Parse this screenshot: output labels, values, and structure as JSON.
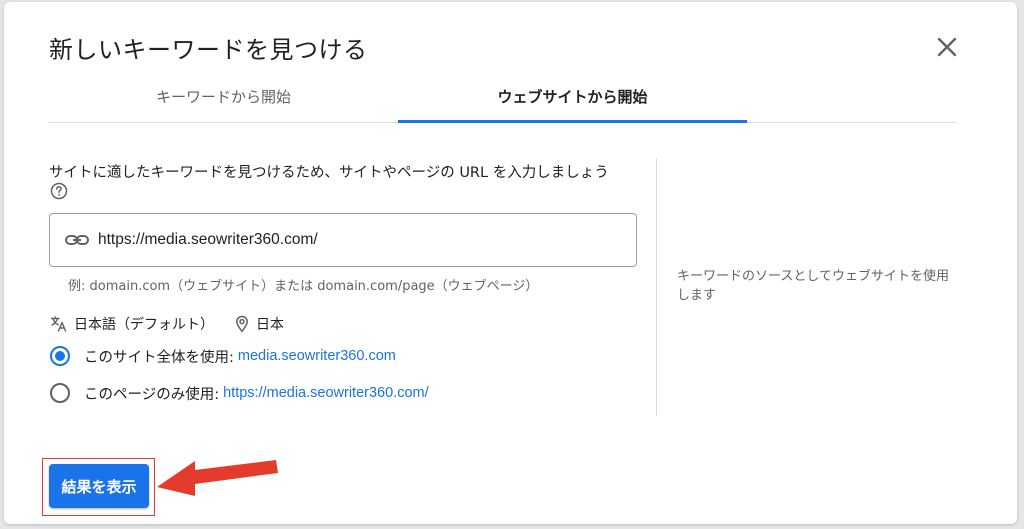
{
  "dialog": {
    "title": "新しいキーワードを見つける"
  },
  "tabs": [
    {
      "label": "キーワードから開始",
      "active": false
    },
    {
      "label": "ウェブサイトから開始",
      "active": true
    }
  ],
  "form": {
    "prompt": "サイトに適したキーワードを見つけるため、サイトやページの URL を入力しましょう",
    "url_value": "https://media.seowriter360.com/",
    "example": "例: domain.com（ウェブサイト）または domain.com/page（ウェブページ）",
    "language": "日本語（デフォルト）",
    "location": "日本",
    "options": [
      {
        "label": "このサイト全体を使用:",
        "link": "media.seowriter360.com",
        "checked": true
      },
      {
        "label": "このページのみ使用:",
        "link": "https://media.seowriter360.com/",
        "checked": false
      }
    ]
  },
  "side_note": "キーワードのソースとしてウェブサイトを使用します",
  "submit_label": "結果を表示",
  "colors": {
    "accent": "#1a73e8",
    "annotation": "#e53b2c"
  },
  "icons": {
    "close": "close-icon",
    "help": "help-icon",
    "link": "link-icon",
    "language": "translate-icon",
    "location": "location-pin-icon"
  }
}
